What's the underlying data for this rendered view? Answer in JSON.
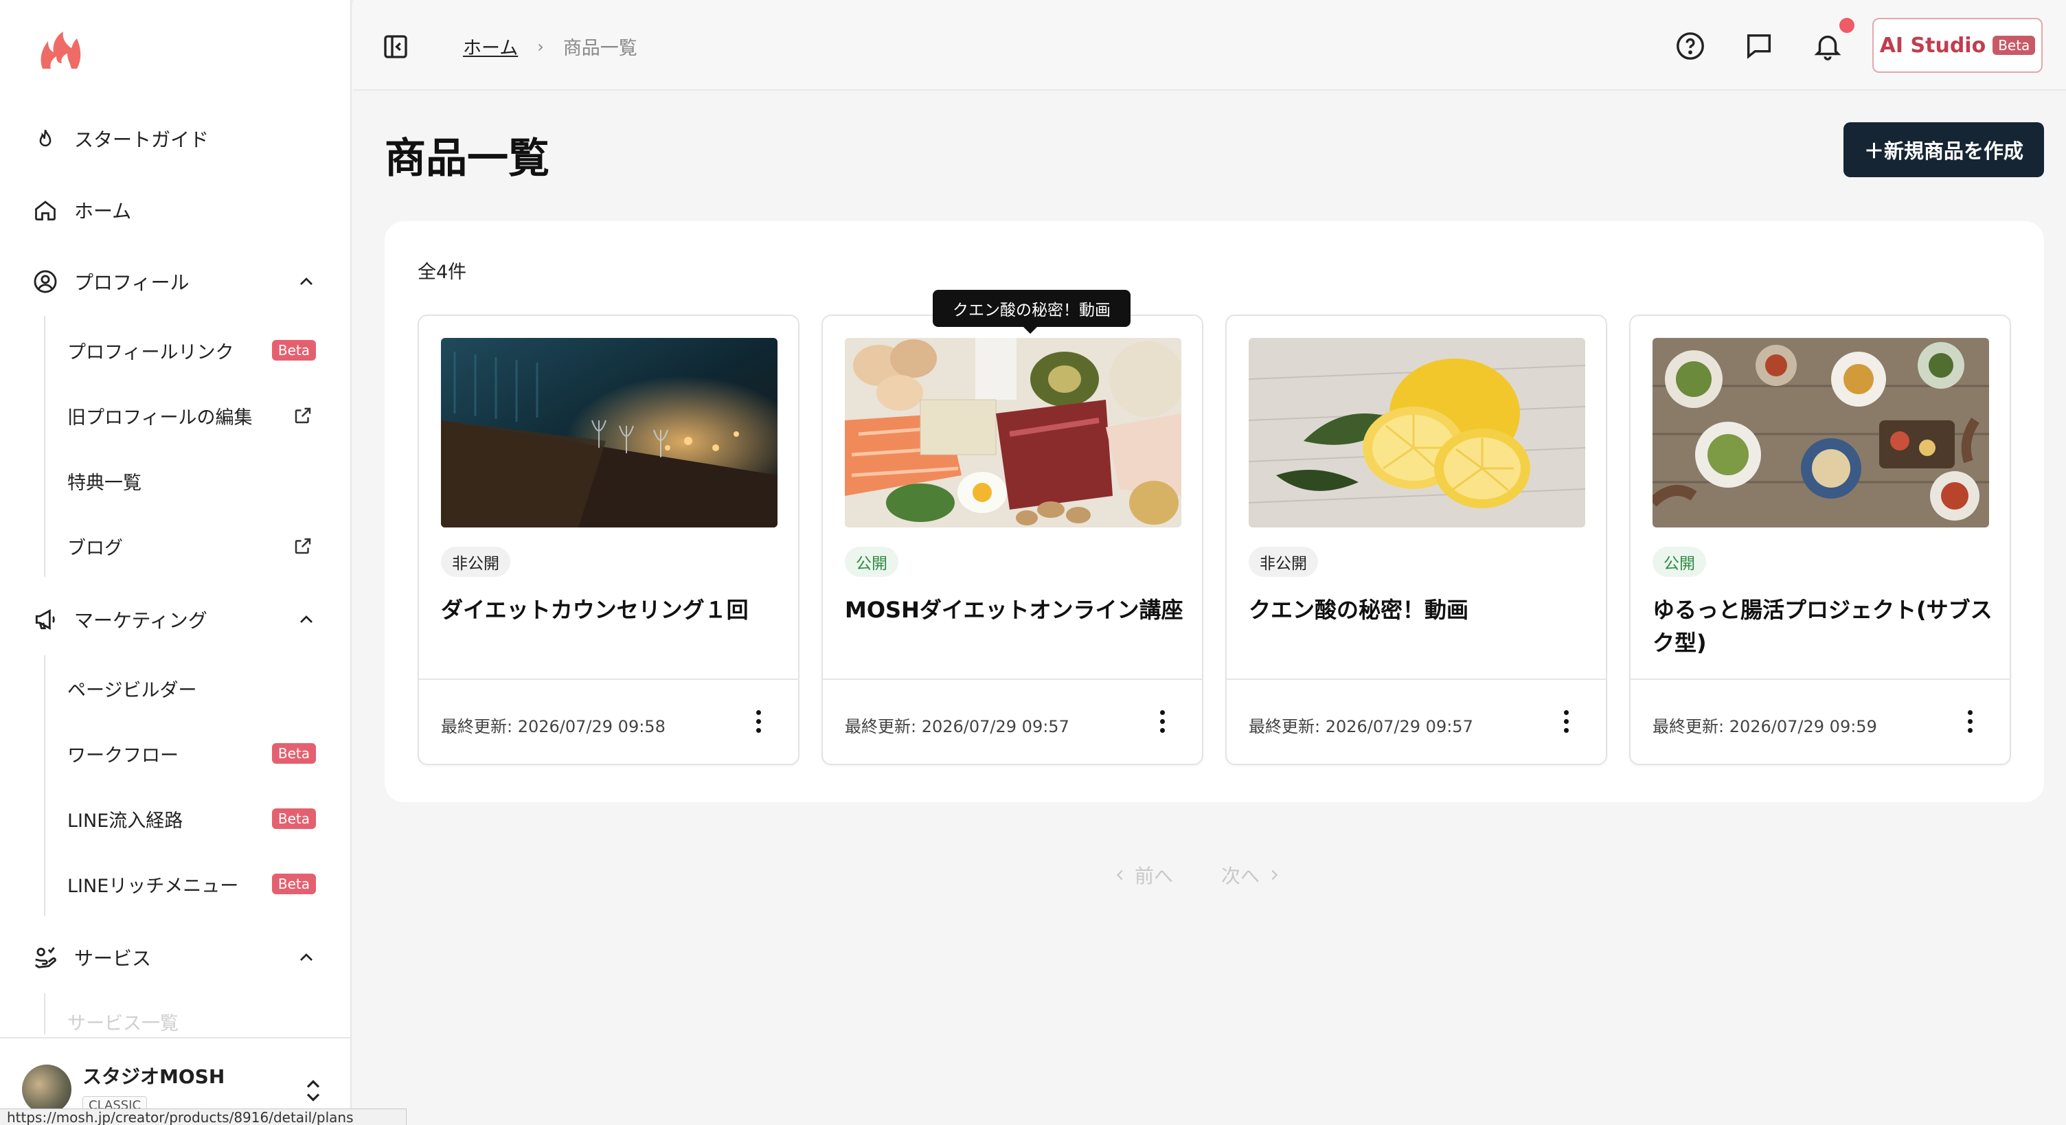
{
  "sidebar": {
    "items": [
      {
        "label": "スタートガイド",
        "icon": "flame-icon"
      },
      {
        "label": "ホーム",
        "icon": "home-icon"
      },
      {
        "label": "プロフィール",
        "icon": "user-circle-icon"
      },
      {
        "label": "マーケティング",
        "icon": "megaphone-icon"
      },
      {
        "label": "サービス",
        "icon": "service-icon"
      }
    ],
    "profile_sub": [
      {
        "label": "プロフィールリンク",
        "badge": "Beta"
      },
      {
        "label": "旧プロフィールの編集"
      },
      {
        "label": "特典一覧"
      },
      {
        "label": "ブログ"
      }
    ],
    "marketing_sub": [
      {
        "label": "ページビルダー"
      },
      {
        "label": "ワークフロー",
        "badge": "Beta"
      },
      {
        "label": "LINE流入経路",
        "badge": "Beta"
      },
      {
        "label": "LINEリッチメニュー",
        "badge": "Beta"
      }
    ],
    "service_sub": [
      {
        "label": "サービス一覧"
      }
    ],
    "account": {
      "name": "スタジオMOSH",
      "plan": "CLASSIC"
    },
    "status_url": "https://mosh.jp/creator/products/8916/detail/plans"
  },
  "header": {
    "breadcrumb_home": "ホーム",
    "breadcrumb_sep": "›",
    "breadcrumb_current": "商品一覧",
    "ai_studio_label": "AI Studio",
    "ai_studio_badge": "Beta"
  },
  "main": {
    "title": "商品一覧",
    "create_button": "＋新規商品を作成",
    "count": "全4件",
    "tooltip": "クエン酸の秘密！動画",
    "products": [
      {
        "status": "非公開",
        "title": "ダイエットカウンセリング１回",
        "updated": "最終更新: 2026/07/29 09:58"
      },
      {
        "status": "公開",
        "title": "MOSHダイエットオンライン講座",
        "updated": "最終更新: 2026/07/29 09:57"
      },
      {
        "status": "非公開",
        "title": "クエン酸の秘密！動画",
        "updated": "最終更新: 2026/07/29 09:57"
      },
      {
        "status": "公開",
        "title": "ゆるっと腸活プロジェクト(サブスク型)",
        "updated": "最終更新: 2026/07/29 09:59"
      }
    ],
    "pager": {
      "prev": "前へ",
      "next": "次へ"
    }
  },
  "colors": {
    "accent": "#e5606f",
    "primary_button": "#152533",
    "public_badge": "#2f8a45"
  }
}
